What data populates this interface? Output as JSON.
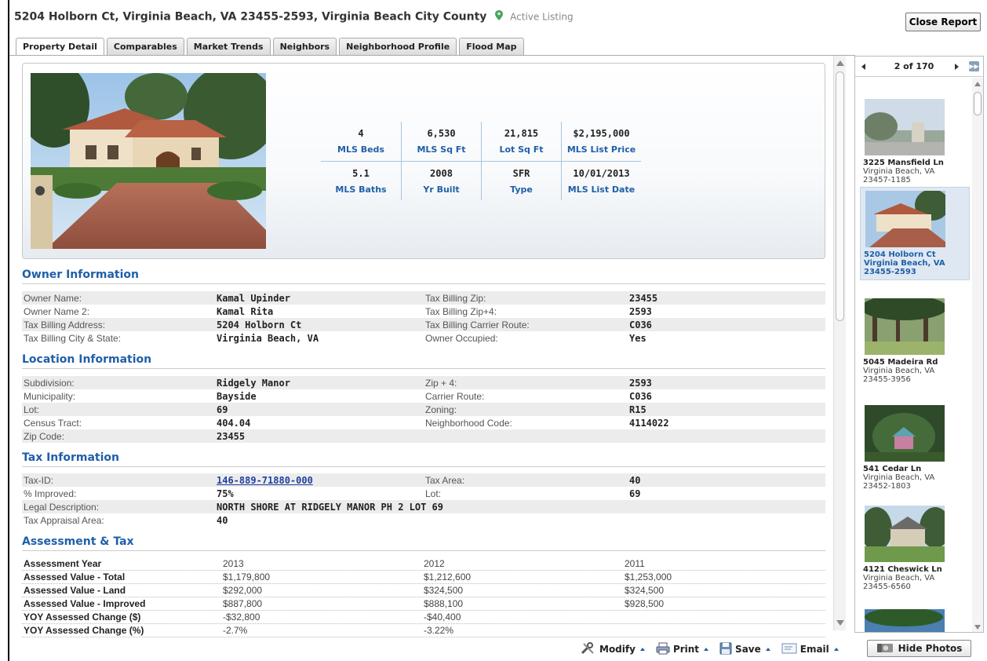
{
  "header": {
    "address": "5204 Holborn Ct, Virginia Beach, VA 23455-2593, Virginia Beach City County",
    "status": "Active Listing",
    "close_label": "Close Report"
  },
  "tabs": [
    {
      "label": "Property Detail"
    },
    {
      "label": "Comparables"
    },
    {
      "label": "Market Trends"
    },
    {
      "label": "Neighbors"
    },
    {
      "label": "Neighborhood Profile"
    },
    {
      "label": "Flood Map"
    }
  ],
  "summary": {
    "row1": [
      {
        "value": "4",
        "label": "MLS Beds"
      },
      {
        "value": "6,530",
        "label": "MLS Sq Ft"
      },
      {
        "value": "21,815",
        "label": "Lot Sq Ft"
      },
      {
        "value": "$2,195,000",
        "label": "MLS List Price"
      }
    ],
    "row2": [
      {
        "value": "5.1",
        "label": "MLS Baths"
      },
      {
        "value": "2008",
        "label": "Yr Built"
      },
      {
        "value": "SFR",
        "label": "Type"
      },
      {
        "value": "10/01/2013",
        "label": "MLS List Date"
      }
    ]
  },
  "owner": {
    "title": "Owner Information",
    "rows": [
      {
        "k1": "Owner Name:",
        "v1": "Kamal Upinder",
        "k2": "Tax Billing Zip:",
        "v2": "23455"
      },
      {
        "k1": "Owner Name 2:",
        "v1": "Kamal Rita",
        "k2": "Tax Billing Zip+4:",
        "v2": "2593"
      },
      {
        "k1": "Tax Billing Address:",
        "v1": "5204 Holborn Ct",
        "k2": "Tax Billing Carrier Route:",
        "v2": "C036"
      },
      {
        "k1": "Tax Billing City & State:",
        "v1": "Virginia Beach, VA",
        "k2": "Owner Occupied:",
        "v2": "Yes"
      }
    ]
  },
  "location": {
    "title": "Location Information",
    "rows": [
      {
        "k1": "Subdivision:",
        "v1": "Ridgely Manor",
        "k2": "Zip + 4:",
        "v2": "2593"
      },
      {
        "k1": "Municipality:",
        "v1": "Bayside",
        "k2": "Carrier Route:",
        "v2": "C036"
      },
      {
        "k1": "Lot:",
        "v1": "69",
        "k2": "Zoning:",
        "v2": "R15"
      },
      {
        "k1": "Census Tract:",
        "v1": "404.04",
        "k2": "Neighborhood Code:",
        "v2": "4114022"
      },
      {
        "k1": "Zip Code:",
        "v1": "23455",
        "k2": "",
        "v2": ""
      }
    ]
  },
  "tax": {
    "title": "Tax Information",
    "tax_id_label": "Tax-ID:",
    "tax_id": "146-889-71880-000",
    "tax_area_label": "Tax Area:",
    "tax_area": "40",
    "improved_label": "% Improved:",
    "improved": "75%",
    "lot_label": "Lot:",
    "lot": "69",
    "legal_label": "Legal Description:",
    "legal": "NORTH SHORE AT RIDGELY MANOR PH 2 LOT 69",
    "appraisal_label": "Tax Appraisal Area:",
    "appraisal": "40"
  },
  "assessment": {
    "title": "Assessment & Tax",
    "rows": [
      {
        "label": "Assessment Year",
        "c1": "2013",
        "c2": "2012",
        "c3": "2011"
      },
      {
        "label": "Assessed Value - Total",
        "c1": "$1,179,800",
        "c2": "$1,212,600",
        "c3": "$1,253,000"
      },
      {
        "label": "Assessed Value - Land",
        "c1": "$292,000",
        "c2": "$324,500",
        "c3": "$324,500"
      },
      {
        "label": "Assessed Value - Improved",
        "c1": "$887,800",
        "c2": "$888,100",
        "c3": "$928,500"
      },
      {
        "label": "YOY Assessed Change ($)",
        "c1": "-$32,800",
        "c2": "-$40,400",
        "c3": ""
      },
      {
        "label": "YOY Assessed Change (%)",
        "c1": "-2.7%",
        "c2": "-3.22%",
        "c3": ""
      }
    ]
  },
  "toolbar": {
    "modify": "Modify",
    "print": "Print",
    "save": "Save",
    "email": "Email"
  },
  "sidebar": {
    "counter": "2 of 170",
    "hide_photos": "Hide Photos",
    "items": [
      {
        "line1": "3225 Mansfield Ln",
        "line2": "Virginia Beach, VA",
        "line3": "23457-1185"
      },
      {
        "line1": "5204 Holborn Ct",
        "line2": "Virginia Beach, VA",
        "line3": "23455-2593"
      },
      {
        "line1": "5045 Madeira Rd",
        "line2": "Virginia Beach, VA",
        "line3": "23455-3956"
      },
      {
        "line1": "541 Cedar Ln",
        "line2": "Virginia Beach, VA",
        "line3": "23452-1803"
      },
      {
        "line1": "4121 Cheswick Ln",
        "line2": "Virginia Beach, VA",
        "line3": "23455-6560"
      }
    ]
  },
  "icons": {
    "pin": "map-pin-icon",
    "modify": "wrench-icon",
    "print": "printer-icon",
    "save": "floppy-disk-icon",
    "email": "email-icon",
    "hide": "camera-icon"
  },
  "colors": {
    "accent": "#1f5fa8",
    "pin": "#4aa55a",
    "stripe": "#ececec"
  }
}
